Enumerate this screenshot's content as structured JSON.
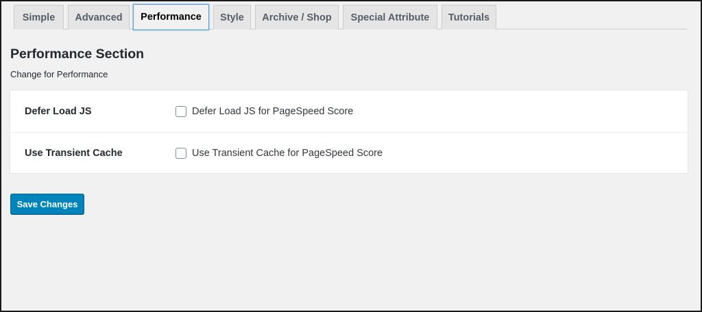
{
  "tabs": [
    {
      "label": "Simple"
    },
    {
      "label": "Advanced"
    },
    {
      "label": "Performance",
      "active": true
    },
    {
      "label": "Style"
    },
    {
      "label": "Archive / Shop"
    },
    {
      "label": "Special Attribute"
    },
    {
      "label": "Tutorials"
    }
  ],
  "section": {
    "title": "Performance Section",
    "description": "Change for Performance"
  },
  "settings": [
    {
      "label": "Defer Load JS",
      "option_text": "Defer Load JS for PageSpeed Score",
      "checked": false
    },
    {
      "label": "Use Transient Cache",
      "option_text": "Use Transient Cache for PageSpeed Score",
      "checked": false
    }
  ],
  "actions": {
    "save_label": "Save Changes"
  },
  "colors": {
    "accent": "#0085ba",
    "page_bg": "#f1f1f1",
    "active_tab_border": "#5b9dd9"
  }
}
